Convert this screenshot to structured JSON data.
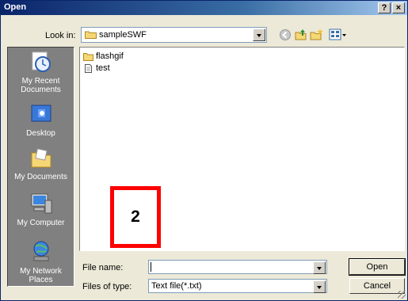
{
  "window": {
    "title": "Open"
  },
  "titlebar": {
    "help": "?",
    "close": "×"
  },
  "lookin": {
    "label": "Look in:",
    "value": "sampleSWF"
  },
  "toolbar": {
    "icons": [
      "back-icon",
      "up-folder-icon",
      "new-folder-icon",
      "views-icon"
    ]
  },
  "places": [
    {
      "label": "My Recent Documents",
      "icon": "recent-documents-icon"
    },
    {
      "label": "Desktop",
      "icon": "desktop-icon"
    },
    {
      "label": "My Documents",
      "icon": "my-documents-icon"
    },
    {
      "label": "My Computer",
      "icon": "my-computer-icon"
    },
    {
      "label": "My Network Places",
      "icon": "network-places-icon"
    }
  ],
  "files": [
    {
      "name": "flashgif",
      "icon": "folder-icon"
    },
    {
      "name": "test",
      "icon": "text-file-icon"
    }
  ],
  "annotation": {
    "label": "2",
    "color": "#ff0000"
  },
  "form": {
    "filename_label": "File name:",
    "filename_value": "",
    "filetype_label": "Files of type:",
    "filetype_value": "Text file(*.txt)"
  },
  "buttons": {
    "open": "Open",
    "cancel": "Cancel"
  }
}
